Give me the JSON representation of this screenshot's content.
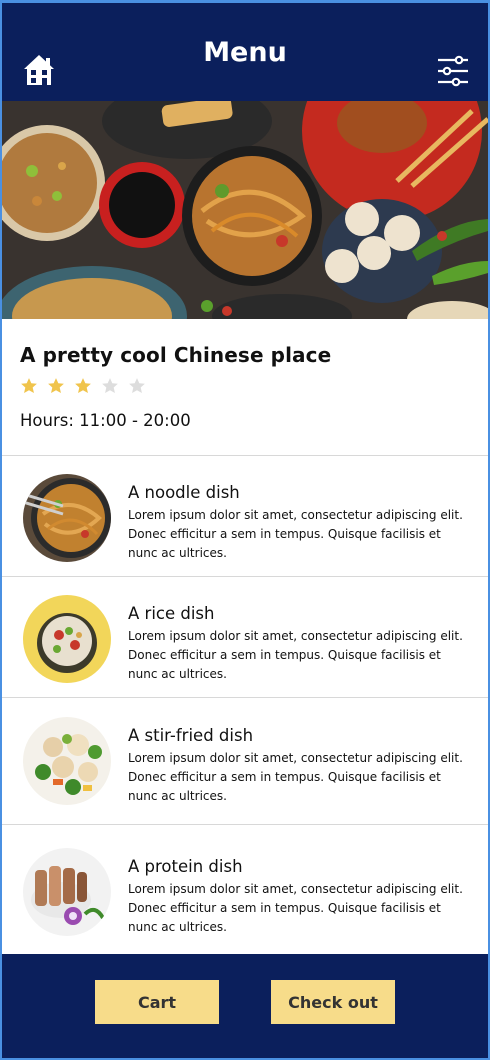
{
  "header": {
    "title": "Menu",
    "home_icon": "home-icon",
    "filter_icon": "sliders-icon"
  },
  "restaurant": {
    "name": "A pretty cool Chinese place",
    "rating": 3,
    "rating_max": 5,
    "hours": "Hours: 11:00 - 20:00"
  },
  "dishes": [
    {
      "title": "A noodle dish",
      "description": "Lorem ipsum dolor sit amet, consectetur adipiscing elit. Donec efficitur a sem in tempus. Quisque facilisis et nunc ac ultrices."
    },
    {
      "title": "A rice dish",
      "description": "Lorem ipsum dolor sit amet, consectetur adipiscing elit. Donec efficitur a sem in tempus. Quisque facilisis et nunc ac ultrices."
    },
    {
      "title": "A stir-fried dish",
      "description": "Lorem ipsum dolor sit amet, consectetur adipiscing elit. Donec efficitur a sem in tempus. Quisque facilisis et nunc ac ultrices."
    },
    {
      "title": "A protein dish",
      "description": "Lorem ipsum dolor sit amet, consectetur adipiscing elit. Donec efficitur a sem in tempus. Quisque facilisis et nunc ac ultrices."
    }
  ],
  "footer": {
    "cart_label": "Cart",
    "checkout_label": "Check out"
  },
  "colors": {
    "navy": "#0b1f5c",
    "button": "#f7dc8a",
    "star_on": "#f0c44c",
    "star_off": "#dddddd"
  }
}
